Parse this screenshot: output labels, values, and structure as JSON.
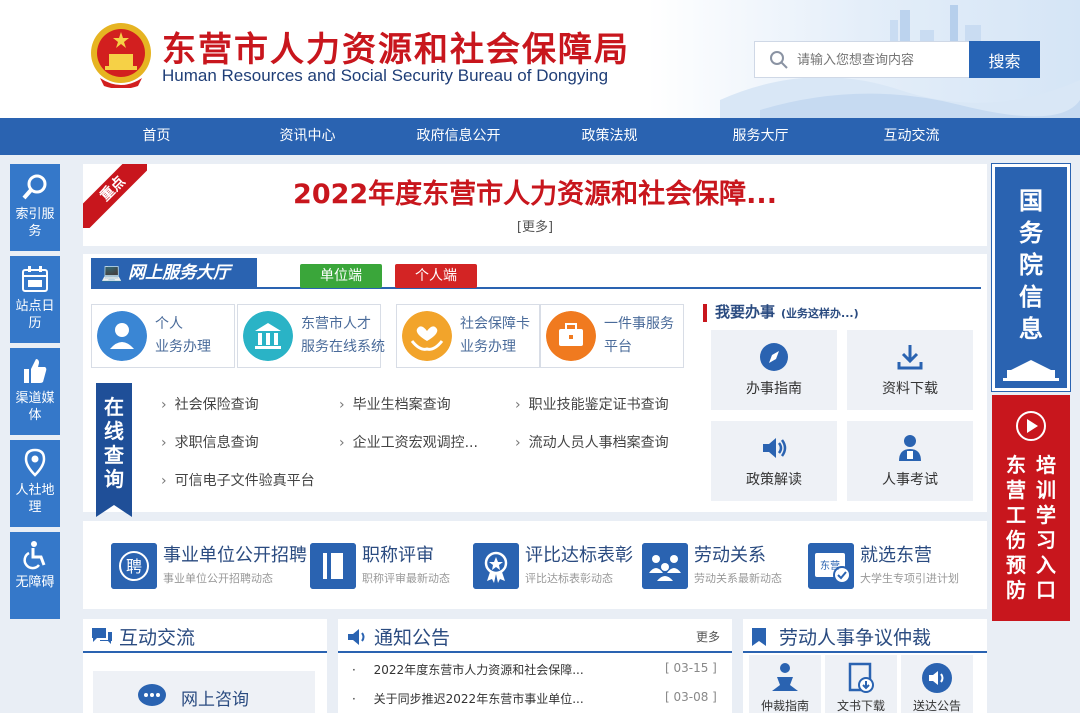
{
  "header": {
    "title": "东营市人力资源和社会保障局",
    "subtitle": "Human Resources and Social Security Bureau of Dongying",
    "search_placeholder": "请输入您想查询内容",
    "search_button": "搜索"
  },
  "nav": [
    "首页",
    "资讯中心",
    "政府信息公开",
    "政策法规",
    "服务大厅",
    "互动交流"
  ],
  "left_sidebar": [
    {
      "label": "索引服务",
      "icon": "search-icon"
    },
    {
      "label": "站点日历",
      "icon": "calendar-icon"
    },
    {
      "label": "渠道媒体",
      "icon": "thumbs-up-icon"
    },
    {
      "label": "人社地理",
      "icon": "location-pin-icon"
    },
    {
      "label": "无障碍",
      "icon": "wheelchair-icon"
    }
  ],
  "right_float": {
    "top_text": "国务院信息",
    "bottom_col1": "东营工伤预防",
    "bottom_col2": "培训学习入口"
  },
  "headline": {
    "badge": "重点",
    "title": "2022年度东营市人力资源和社会保障...",
    "more": "[更多]"
  },
  "service": {
    "tab": "网上服务大厅",
    "unit_button": "单位端",
    "person_button": "个人端",
    "cards": [
      {
        "line1": "个人",
        "line2": "业务办理",
        "color": "#3a86d4"
      },
      {
        "line1": "东营市人才",
        "line2": "服务在线系统",
        "color": "#2ab3c6"
      },
      {
        "line1": "社会保障卡",
        "line2": "业务办理",
        "color": "#f2a42b"
      },
      {
        "line1": "一件事服务",
        "line2": "平台",
        "color": "#f07a1f"
      }
    ],
    "query_tag": "在线查询",
    "queries": [
      "社会保险查询",
      "毕业生档案查询",
      "职业技能鉴定证书查询",
      "求职信息查询",
      "企业工资宏观调控...",
      "流动人员人事档案查询",
      "可信电子文件验真平台"
    ],
    "todo_title": "我要办事",
    "todo_hint": "(业务这样办...)",
    "todo": [
      {
        "label": "办事指南",
        "icon": "compass-icon"
      },
      {
        "label": "资料下载",
        "icon": "download-icon"
      },
      {
        "label": "政策解读",
        "icon": "speaker-icon"
      },
      {
        "label": "人事考试",
        "icon": "exam-person-icon"
      }
    ]
  },
  "categories": [
    {
      "title": "事业单位公开招聘",
      "sub": "事业单位公开招聘动态",
      "icon": "recruit-icon"
    },
    {
      "title": "职称评审",
      "sub": "职称评审最新动态",
      "icon": "book-icon"
    },
    {
      "title": "评比达标表彰",
      "sub": "评比达标表彰动态",
      "icon": "medal-icon"
    },
    {
      "title": "劳动关系",
      "sub": "劳动关系最新动态",
      "icon": "people-icon"
    },
    {
      "title": "就选东营",
      "sub": "大学生专项引进计划",
      "icon": "dongying-icon",
      "badge": "东营"
    }
  ],
  "panels": {
    "interact": {
      "title": "互动交流",
      "consult": "网上咨询"
    },
    "notice": {
      "title": "通知公告",
      "more": "更多",
      "items": [
        {
          "text": "2022年度东营市人力资源和社会保障...",
          "date": "[ 03-15 ]"
        },
        {
          "text": "关于同步推迟2022年东营市事业单位...",
          "date": "[ 03-08 ]"
        }
      ]
    },
    "arbitration": {
      "title": "劳动人事争议仲裁",
      "tiles": [
        "仲裁指南",
        "文书下载",
        "送达公告"
      ]
    }
  },
  "colors": {
    "brand_red": "#c8161d",
    "brand_blue": "#2a63b1",
    "sidebar_blue": "#3578c9"
  }
}
